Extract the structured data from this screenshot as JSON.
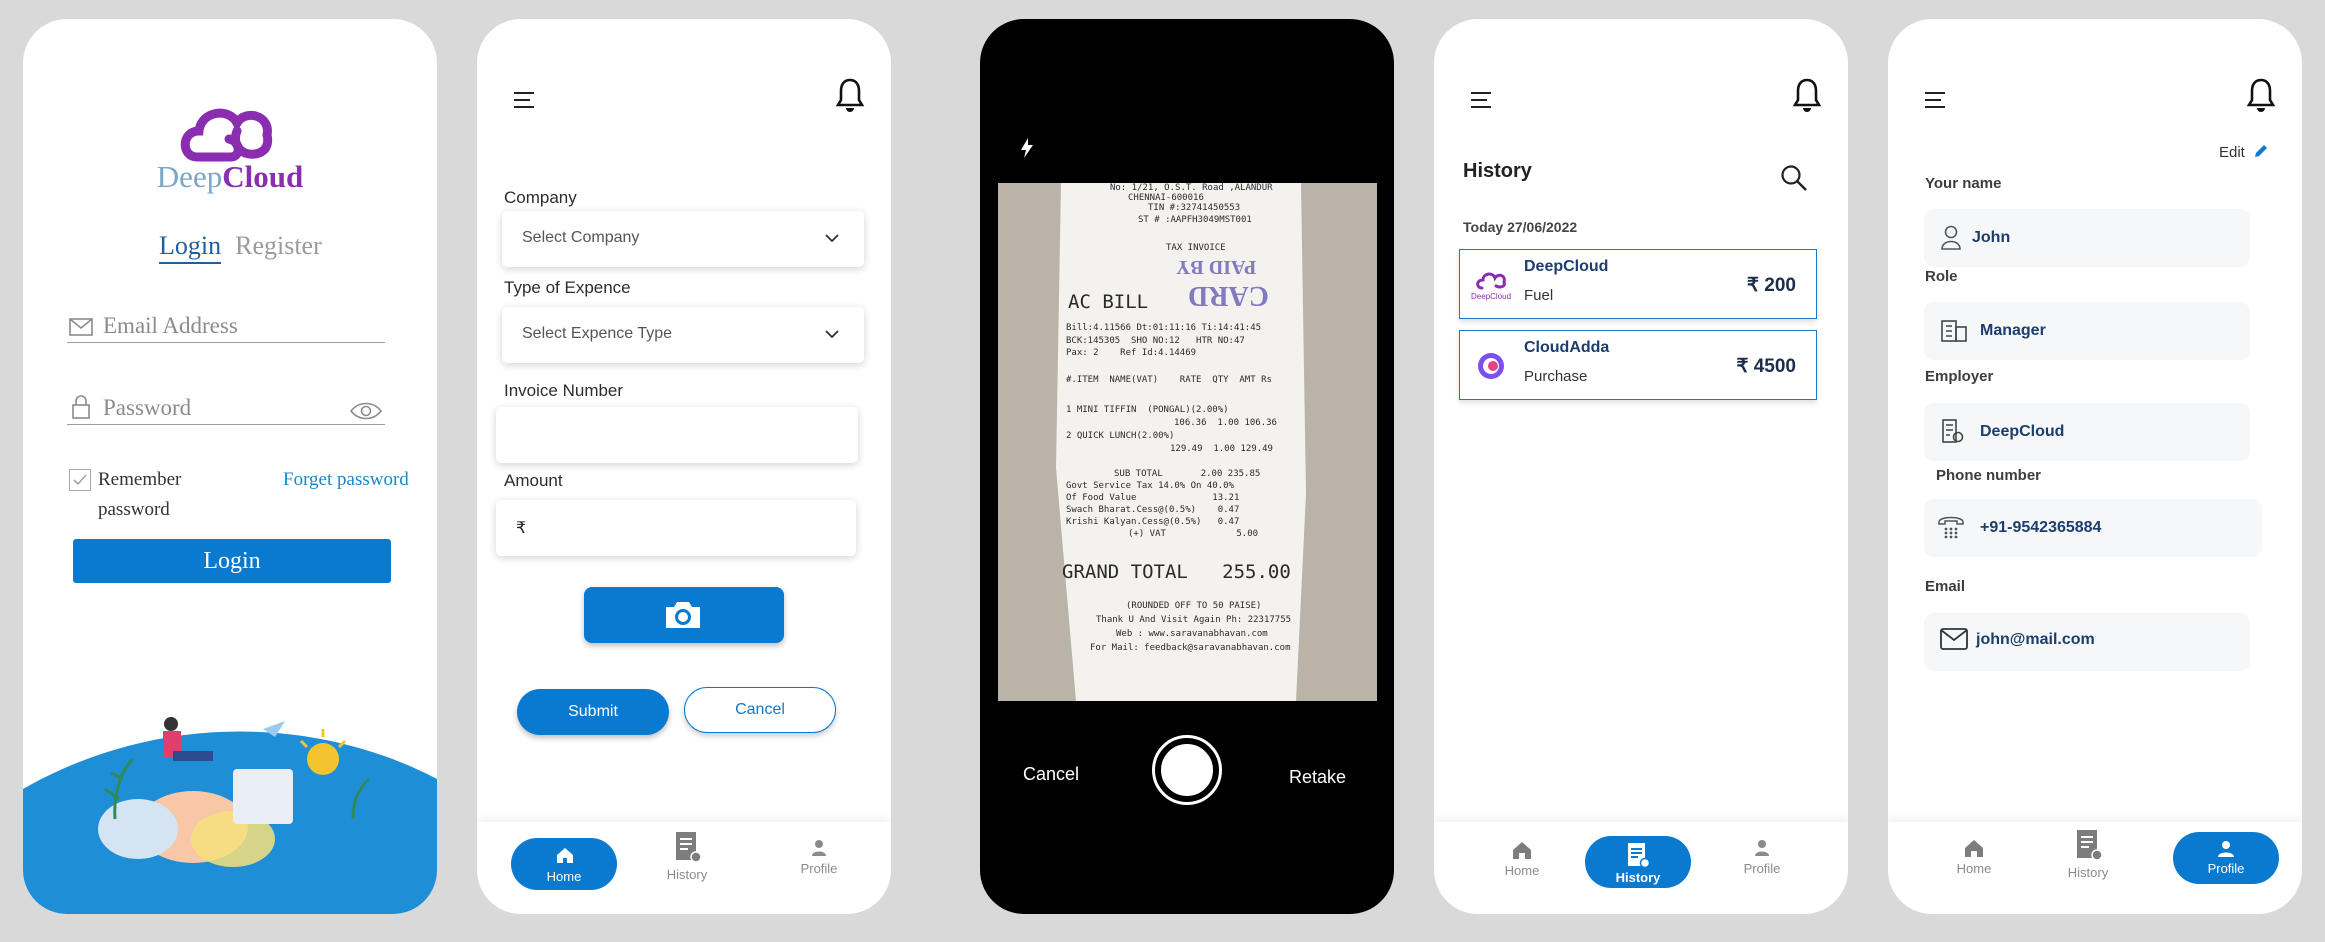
{
  "login": {
    "brand_deep": "Deep",
    "brand_cloud": "Cloud",
    "tab_login": "Login",
    "tab_register": "Register",
    "email_placeholder": "Email Address",
    "password_placeholder": "Password",
    "remember_label_1": "Remember",
    "remember_label_2": "password",
    "forget_password": "Forget password",
    "login_button": "Login"
  },
  "expense_form": {
    "company_label": "Company",
    "company_placeholder": "Select Company",
    "type_label": "Type of Expence",
    "type_placeholder": "Select Expence Type",
    "invoice_label": "Invoice Number",
    "invoice_value": "",
    "amount_label": "Amount",
    "currency_symbol": "₹",
    "submit": "Submit",
    "cancel": "Cancel"
  },
  "camera": {
    "cancel": "Cancel",
    "retake": "Retake",
    "receipt_lines": [
      "No: 1/21, O.S.T. Road ,ALANDUR",
      "CHENNAI-600016",
      "TIN #:32741450553",
      "ST # :AAPFH3049MST001",
      "TAX INVOICE",
      "AC BILL",
      "Bill:4.11566 Dt:01:11:16 Ti:14:41:45",
      "BCK:145305  SHO NO:12   HTR NO:47",
      "Pax: 2    Ref Id:4.14469",
      "#.ITEM  NAME(VAT)    RATE  QTY  AMT Rs",
      "1 MINI TIFFIN  (PONGAL)(2.00%)",
      "106.36  1.00 106.36",
      "2 QUICK LUNCH(2.00%)",
      "129.49  1.00 129.49",
      "SUB TOTAL       2.00 235.85",
      "Govt Service Tax 14.0% On 40.0%",
      "Of Food Value              13.21",
      "Swach Bharat.Cess@(0.5%)    0.47",
      "Krishi Kalyan.Cess@(0.5%)   0.47",
      "(+) VAT             5.00",
      "GRAND TOTAL   255.00",
      "(ROUNDED OFF TO 50 PAISE)",
      "Thank U And Visit Again Ph: 22317755",
      "Web : www.saravanabhavan.com",
      "For Mail: feedback@saravanabhavan.com"
    ],
    "stamp_1": "CARD",
    "stamp_2": "PAID BY"
  },
  "history": {
    "title": "History",
    "date": "Today 27/06/2022",
    "items": [
      {
        "company": "DeepCloud",
        "category": "Fuel",
        "amount": "₹ 200",
        "logo_text": "DeepCloud"
      },
      {
        "company": "CloudAdda",
        "category": "Purchase",
        "amount": "₹ 4500"
      }
    ]
  },
  "profile": {
    "edit": "Edit",
    "name_label": "Your name",
    "name": "John",
    "role_label": "Role",
    "role": "Manager",
    "employer_label": "Employer",
    "employer": "DeepCloud",
    "phone_label": "Phone number",
    "phone": "+91-9542365884",
    "email_label": "Email",
    "email": "john@mail.com"
  },
  "nav": {
    "home": "Home",
    "history": "History",
    "profile": "Profile"
  },
  "colors": {
    "primary": "#0a7ad1",
    "brand_purple": "#8a2db0",
    "brand_blue": "#7aa6c8",
    "text_navy": "#1c3d6e"
  }
}
